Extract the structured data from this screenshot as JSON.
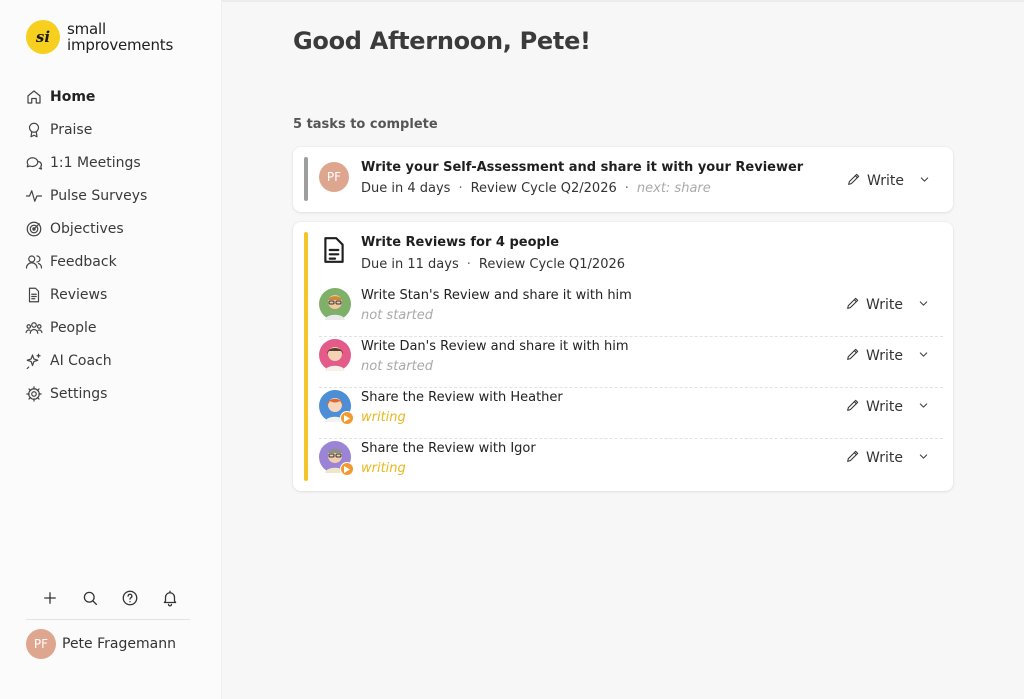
{
  "app": {
    "logo_text_line1": "small",
    "logo_text_line2": "improvements",
    "logo_mark": "si"
  },
  "sidebar": {
    "items": [
      {
        "label": "Home",
        "icon": "home-icon",
        "active": true
      },
      {
        "label": "Praise",
        "icon": "award-icon"
      },
      {
        "label": "1:1 Meetings",
        "icon": "chat-bubbles-icon"
      },
      {
        "label": "Pulse Surveys",
        "icon": "pulse-icon"
      },
      {
        "label": "Objectives",
        "icon": "target-icon"
      },
      {
        "label": "Feedback",
        "icon": "people-icon"
      },
      {
        "label": "Reviews",
        "icon": "document-icon"
      },
      {
        "label": "People",
        "icon": "group-icon"
      },
      {
        "label": "AI Coach",
        "icon": "sparkle-icon"
      },
      {
        "label": "Settings",
        "icon": "gear-icon"
      }
    ],
    "toolbar": [
      "plus-icon",
      "search-icon",
      "help-icon",
      "bell-icon"
    ],
    "user": {
      "initials": "PF",
      "name": "Pete Fragemann"
    }
  },
  "main": {
    "greeting": "Good Afternoon, Pete!",
    "tasks_count": "5 tasks to complete",
    "task1": {
      "initials": "PF",
      "title": "Write your Self-Assessment and share it with your Reviewer",
      "due": "Due in 4 days",
      "cycle": "Review Cycle Q2/2026",
      "next": "next: share",
      "action": "Write"
    },
    "task2": {
      "title": "Write Reviews for 4 people",
      "due": "Due in 11 days",
      "cycle": "Review Cycle Q1/2026",
      "rows": [
        {
          "title": "Write Stan's Review and share it with him",
          "status": "not started",
          "action": "Write"
        },
        {
          "title": "Write Dan's Review and share it with him",
          "status": "not started",
          "action": "Write"
        },
        {
          "title": "Share the Review with Heather",
          "status": "writing",
          "action": "Write"
        },
        {
          "title": "Share the Review with Igor",
          "status": "writing",
          "action": "Write"
        }
      ]
    }
  },
  "colors": {
    "brand_yellow": "#f6cf1f",
    "progress_bar_yellow": "#f4c52a",
    "status_writing": "#e8b91f",
    "avatar_pf": "#dfa68f"
  }
}
